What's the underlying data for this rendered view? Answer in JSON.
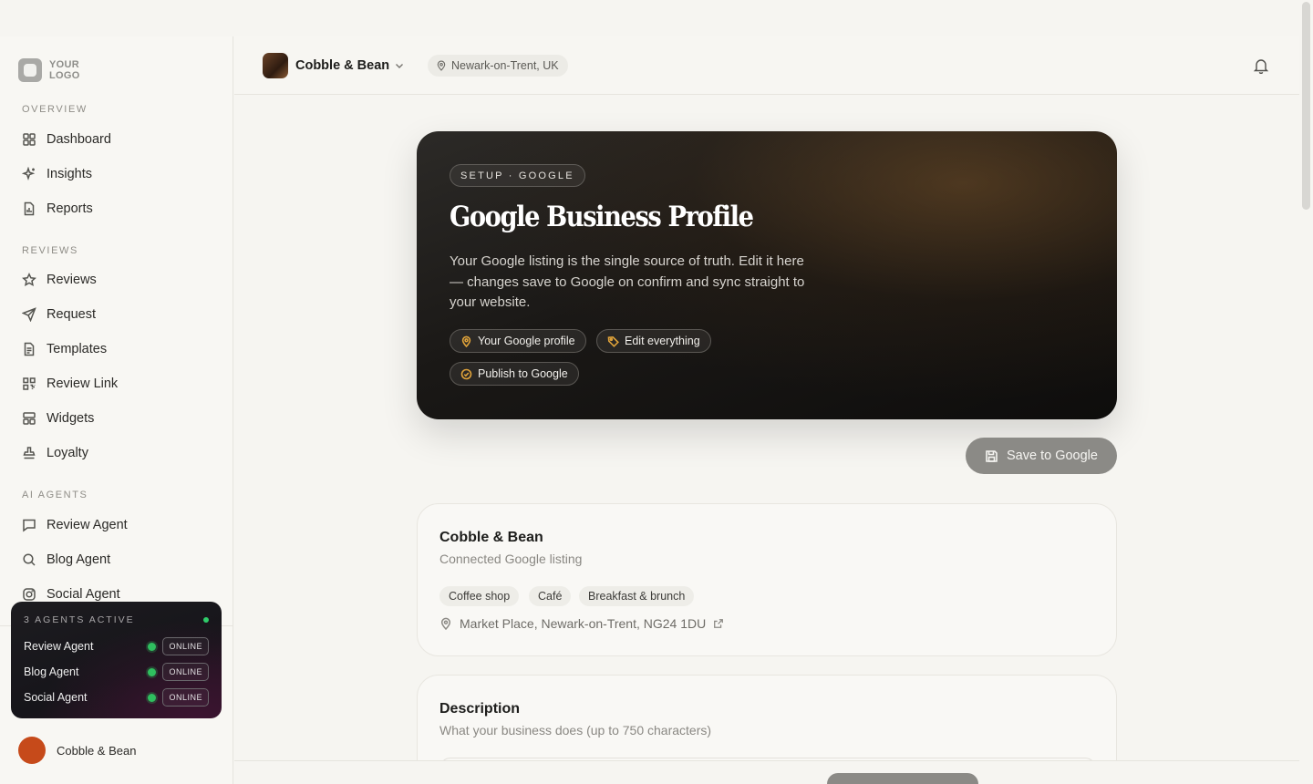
{
  "logo": {
    "line1": "YOUR",
    "line2": "LOGO"
  },
  "sidebar": {
    "sections": [
      {
        "label": "OVERVIEW",
        "items": [
          {
            "label": "Dashboard",
            "icon": "grid-icon"
          },
          {
            "label": "Insights",
            "icon": "sparkle-icon"
          },
          {
            "label": "Reports",
            "icon": "report-icon"
          }
        ]
      },
      {
        "label": "REVIEWS",
        "items": [
          {
            "label": "Reviews",
            "icon": "star-icon"
          },
          {
            "label": "Request",
            "icon": "send-icon"
          },
          {
            "label": "Templates",
            "icon": "document-icon"
          },
          {
            "label": "Review Link",
            "icon": "qr-icon"
          },
          {
            "label": "Widgets",
            "icon": "widget-icon"
          },
          {
            "label": "Loyalty",
            "icon": "stamp-icon"
          }
        ]
      },
      {
        "label": "AI AGENTS",
        "items": [
          {
            "label": "Review Agent",
            "icon": "chat-icon"
          },
          {
            "label": "Blog Agent",
            "icon": "search-icon"
          },
          {
            "label": "Social Agent",
            "icon": "instagram-icon"
          }
        ]
      }
    ],
    "agents_card": {
      "title": "3 AGENTS ACTIVE",
      "agents": [
        {
          "name": "Review Agent",
          "status": "ONLINE"
        },
        {
          "name": "Blog Agent",
          "status": "ONLINE"
        },
        {
          "name": "Social Agent",
          "status": "ONLINE"
        }
      ]
    },
    "user": {
      "name": "Cobble & Bean"
    }
  },
  "topbar": {
    "business_name": "Cobble & Bean",
    "location": "Newark-on-Trent, UK"
  },
  "hero": {
    "badge": "SETUP · GOOGLE",
    "title": "Google Business Profile",
    "description": "Your Google listing is the single source of truth. Edit it here — changes save to Google on confirm and sync straight to your website.",
    "chips": [
      {
        "label": "Your Google profile",
        "icon": "pin-icon"
      },
      {
        "label": "Edit everything",
        "icon": "tag-icon"
      },
      {
        "label": "Publish to Google",
        "icon": "check-circle-icon"
      }
    ]
  },
  "save_button": "Save to Google",
  "listing_card": {
    "title": "Cobble & Bean",
    "subtitle": "Connected Google listing",
    "categories": [
      "Coffee shop",
      "Café",
      "Breakfast & brunch"
    ],
    "address": "Market Place, Newark-on-Trent, NG24 1DU"
  },
  "description_card": {
    "title": "Description",
    "subtitle": "What your business does (up to 750 characters)"
  },
  "colors": {
    "accent": "#e0a33a",
    "online": "#2fbf5f",
    "save_button": "#8b8a86"
  }
}
